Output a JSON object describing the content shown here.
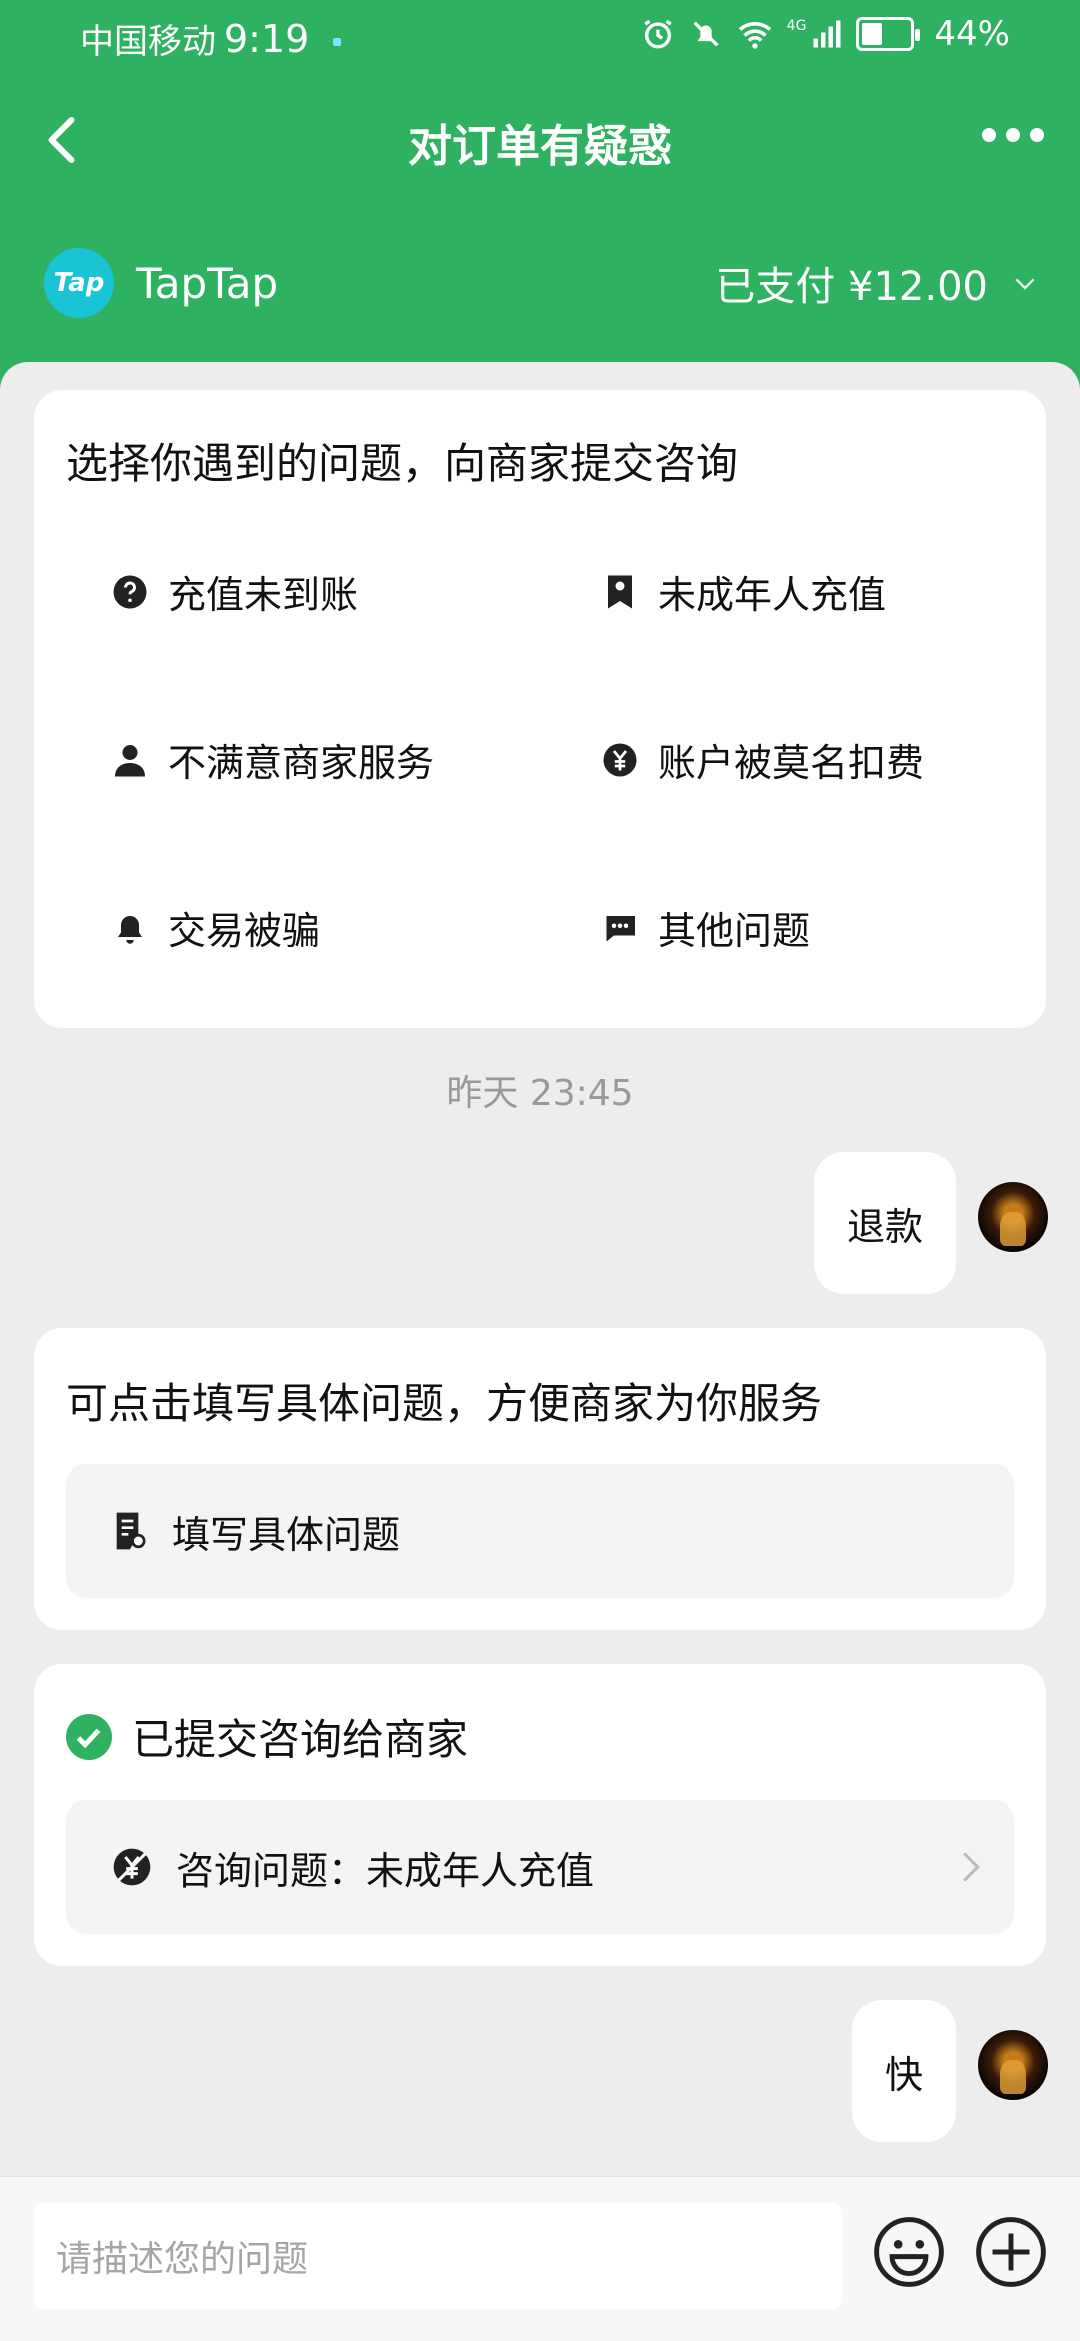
{
  "status_bar": {
    "carrier": "中国移动",
    "time": "9:19",
    "signal": "4G",
    "battery": "44%"
  },
  "nav": {
    "title": "对订单有疑惑"
  },
  "merchant": {
    "name": "TapTap",
    "logo_text": "Tap",
    "paid_text": "已支付 ¥12.00"
  },
  "question_card": {
    "title": "选择你遇到的问题，向商家提交咨询",
    "options": [
      {
        "label": "充值未到账",
        "icon": "question-circle-icon"
      },
      {
        "label": "未成年人充值",
        "icon": "child-bookmark-icon"
      },
      {
        "label": "不满意商家服务",
        "icon": "person-icon"
      },
      {
        "label": "账户被莫名扣费",
        "icon": "yuan-circle-icon"
      },
      {
        "label": "交易被骗",
        "icon": "bell-icon"
      },
      {
        "label": "其他问题",
        "icon": "chat-dots-icon"
      }
    ]
  },
  "messages": {
    "timestamp": "昨天 23:45",
    "user_msg_1": "退款",
    "fill_card": {
      "title": "可点击填写具体问题，方便商家为你服务",
      "button": "填写具体问题"
    },
    "submitted_card": {
      "title": "已提交咨询给商家",
      "label": "咨询问题：未成年人充值"
    },
    "user_msg_2": "快"
  },
  "input": {
    "placeholder": "请描述您的问题"
  },
  "colors": {
    "brand_green": "#2fb162",
    "background": "#ededed"
  }
}
